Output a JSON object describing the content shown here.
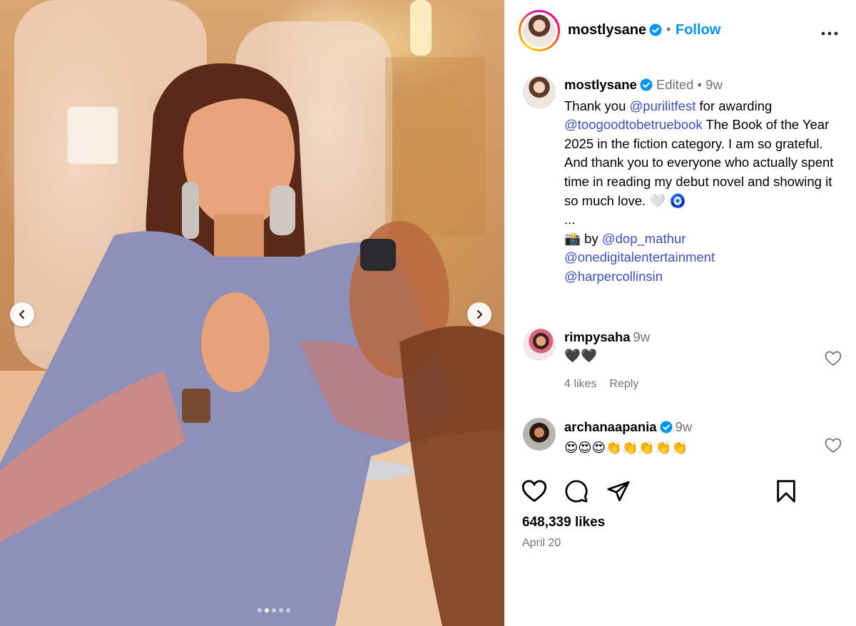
{
  "post": {
    "username": "mostlysane",
    "follow_label": "Follow",
    "separator": "•",
    "edited_label": "Edited",
    "time_ago": "9w",
    "caption_lines": {
      "l1_pre": "Thank you ",
      "l1_mention": "@purilitfest",
      "l1_post": " for awarding",
      "l2_mention": "@toogoodtobetruebook",
      "l2_post": " The Book of the Year 2025 in the fiction category. I am so grateful.",
      "l3": "And thank you to everyone who actually spent time in reading my debut novel and showing it so much love. 🤍 🧿",
      "l4": "...",
      "l5_pre": "📸 by ",
      "l5_mention": "@dop_mathur",
      "l6_mention": "@onedigitalentertainment",
      "l7_mention": "@harpercollinsin"
    },
    "likes": "648,339 likes",
    "date": "April 20",
    "carousel": {
      "slide_count": 5,
      "active_index": 1
    }
  },
  "comments": [
    {
      "username": "rimpysaha",
      "time": "9w",
      "text": "🖤🖤",
      "likes": "4 likes",
      "reply_label": "Reply",
      "verified": false
    },
    {
      "username": "archanaapania",
      "time": "9w",
      "text": "😍😍😍👏👏👏👏👏",
      "verified": true
    }
  ],
  "icons": {
    "verified": "verified-badge-icon",
    "more": "more-options-icon",
    "like": "heart-icon",
    "comment": "comment-bubble-icon",
    "share": "send-icon",
    "save": "bookmark-icon",
    "prev": "chevron-left-icon",
    "next": "chevron-right-icon"
  },
  "colors": {
    "link": "#0095f6",
    "mention": "#3d4fc4",
    "muted": "#737373",
    "verified": "#0095f6"
  }
}
